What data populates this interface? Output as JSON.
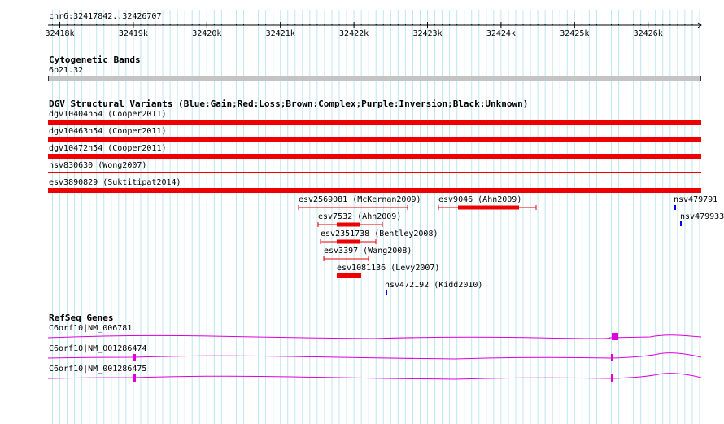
{
  "region": "chr6:32417842..32426707",
  "ruler": {
    "ticks": [
      "32418k",
      "32419k",
      "32420k",
      "32421k",
      "32422k",
      "32423k",
      "32424k",
      "32425k",
      "32426k"
    ]
  },
  "cytobands": {
    "title": "Cytogenetic Bands",
    "band": "6p21.32"
  },
  "dgv": {
    "title": "DGV Structural Variants (Blue:Gain;Red:Loss;Brown:Complex;Purple:Inversion;Black:Unknown)",
    "colors": {
      "loss": "#ee0000",
      "gain": "#0000ee"
    },
    "full_tracks": [
      {
        "label": "dgv10404n54 (Cooper2011)",
        "type": "loss"
      },
      {
        "label": "dgv10463n54 (Cooper2011)",
        "type": "loss"
      },
      {
        "label": "dgv10472n54 (Cooper2011)",
        "type": "loss"
      },
      {
        "label": "nsv830630 (Wong2007)",
        "type": "loss"
      },
      {
        "label": "esv3890829 (Suktitipat2014)",
        "type": "loss"
      }
    ],
    "features": [
      {
        "label": "esv2569081 (McKernan2009)",
        "type": "loss"
      },
      {
        "label": "esv9046 (Ahn2009)",
        "type": "loss"
      },
      {
        "label": "nsv479791",
        "type": "gain"
      },
      {
        "label": "nsv479933",
        "type": "gain"
      },
      {
        "label": "esv7532 (Ahn2009)",
        "type": "loss"
      },
      {
        "label": "esv2351738 (Bentley2008)",
        "type": "loss"
      },
      {
        "label": "esv3397 (Wang2008)",
        "type": "loss"
      },
      {
        "label": "esv1081136 (Levy2007)",
        "type": "loss"
      },
      {
        "label": "nsv472192 (Kidd2010)",
        "type": "gain"
      }
    ]
  },
  "refseq": {
    "title": "RefSeq Genes",
    "color": "#dd00dd",
    "transcripts": [
      {
        "label": "C6orf10|NM_006781"
      },
      {
        "label": "C6orf10|NM_001286474"
      },
      {
        "label": "C6orf10|NM_001286475"
      }
    ]
  }
}
